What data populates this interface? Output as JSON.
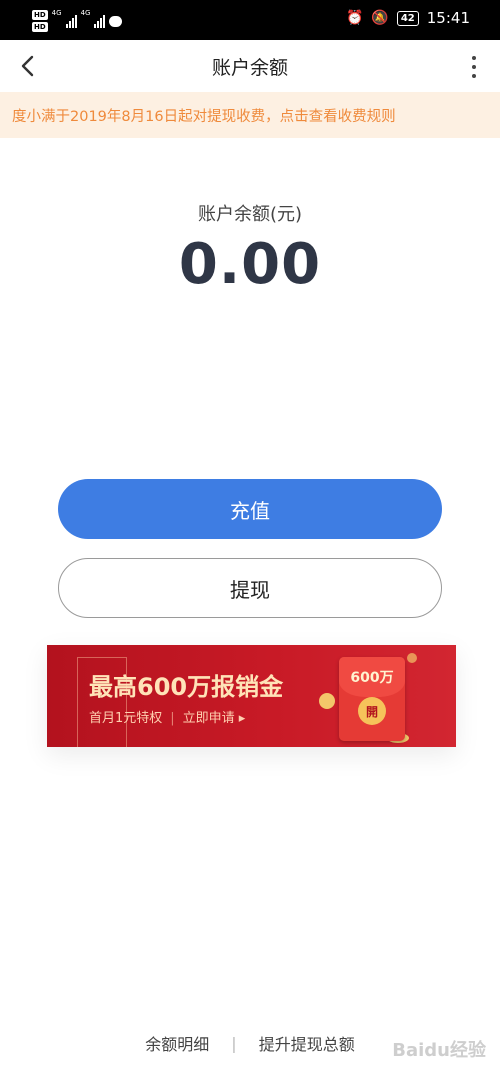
{
  "status_bar": {
    "hd1": "HD",
    "hd2": "HD",
    "net1": "4G",
    "net2": "4G",
    "battery": "42",
    "time": "15:41"
  },
  "navbar": {
    "title": "账户余额"
  },
  "notice": {
    "text": "度小满于2019年8月16日起对提现收费，点击查看收费规则"
  },
  "balance": {
    "label": "账户余额(元)",
    "value": "0.00"
  },
  "actions": {
    "recharge": "充值",
    "withdraw": "提现"
  },
  "banner": {
    "title": "最高600万报销金",
    "sub_left": "首月1元特权",
    "sub_cta": "立即申请 ▸",
    "envelope_amount": "600万",
    "envelope_button": "開"
  },
  "footer": {
    "link1": "余额明细",
    "link2": "提升提现总额"
  },
  "watermark": "Baidu经验",
  "colors": {
    "primary": "#3e7de3",
    "notice_bg": "#fdf0e2",
    "notice_text": "#ef8a3c",
    "banner_red": "#c81a26"
  }
}
